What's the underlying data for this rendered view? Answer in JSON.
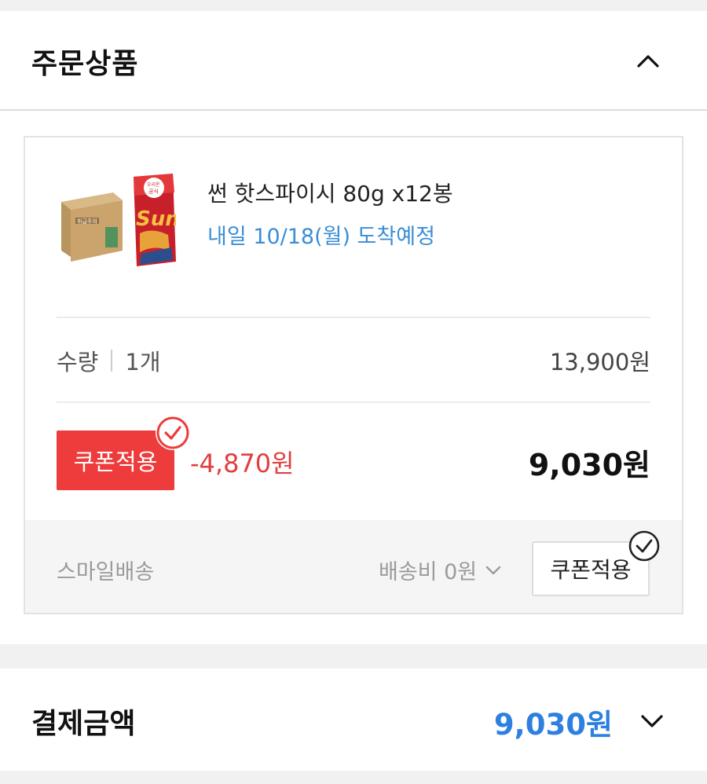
{
  "order": {
    "title": "주문상품",
    "product": {
      "name": "썬 핫스파이시 80g x12봉",
      "delivery": "내일 10/18(월) 도착예정",
      "image_text": {
        "brand": "오리온",
        "badge": "공식",
        "logo": "Sun",
        "box_text": "취급주의"
      }
    },
    "quantity": {
      "label": "수량",
      "value": "1개",
      "price": "13,900원"
    },
    "coupon": {
      "button_label": "쿠폰적용",
      "discount": "-4,870원",
      "final_price": "9,030원"
    },
    "shipping": {
      "label": "스마일배송",
      "fee": "배송비 0원",
      "coupon_button_label": "쿠폰적용"
    }
  },
  "payment": {
    "title": "결제금액",
    "amount": "9,030원"
  },
  "colors": {
    "accent_blue": "#2d7fe0",
    "delivery_blue": "#3a8ed6",
    "coupon_red": "#ee3b3b",
    "discount_red": "#e23e3e"
  },
  "icons": {
    "collapse": "chevron-up-icon",
    "expand": "chevron-down-icon",
    "shipping_dropdown": "chevron-down-icon",
    "coupon_applied": "check-circle-icon"
  }
}
